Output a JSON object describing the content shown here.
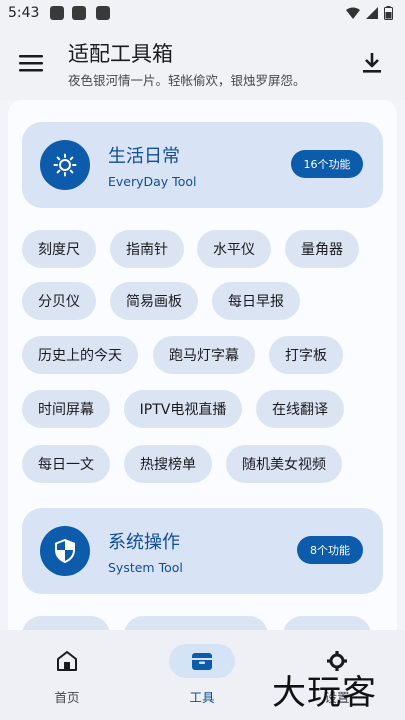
{
  "status_bar": {
    "time": "5:43"
  },
  "app_bar": {
    "title": "适配工具箱",
    "subtitle": "夜色银河情一片。轻帐偷欢，银烛罗屏怨。",
    "menu_icon": "menu-icon",
    "download_icon": "download-icon"
  },
  "sections": [
    {
      "title": "生活日常",
      "subtitle": "EveryDay Tool",
      "badge": "16个功能",
      "icon": "brightness-icon",
      "tools": [
        "刻度尺",
        "指南针",
        "水平仪",
        "量角器",
        "分贝仪",
        "简易画板",
        "每日早报",
        "历史上的今天",
        "跑马灯字幕",
        "打字板",
        "时间屏幕",
        "IPTV电视直播",
        "在线翻译",
        "每日一文",
        "热搜榜单",
        "随机美女视频"
      ]
    },
    {
      "title": "系统操作",
      "subtitle": "System Tool",
      "badge": "8个功能",
      "icon": "shield-icon",
      "tools": []
    }
  ],
  "bottom_nav": [
    {
      "label": "首页",
      "icon": "home-icon",
      "active": false
    },
    {
      "label": "工具",
      "icon": "toolbox-icon",
      "active": true
    },
    {
      "label": "设置",
      "icon": "settings-icon",
      "active": false
    }
  ],
  "watermark": "大玩客",
  "colors": {
    "accent": "#0d5bab",
    "card": "#d8e3f6",
    "chip": "#dbe4f2",
    "background": "#f3f4f9"
  }
}
